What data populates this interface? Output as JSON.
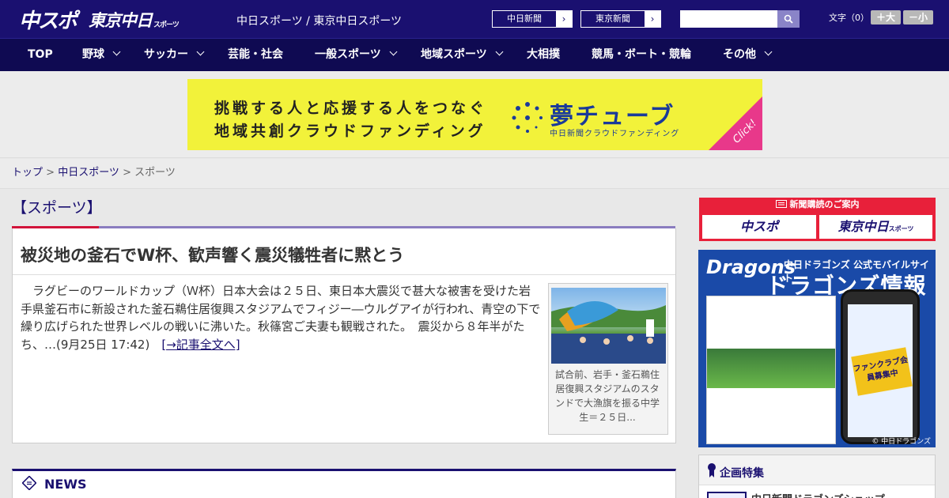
{
  "header": {
    "logo_chuspo": "中スポ",
    "logo_tokyo": "東京中日",
    "logo_tokyo_small": "スポーツ",
    "site_title": "中日スポーツ / 東京中日スポーツ",
    "btn_chunichi": "中日新聞",
    "btn_tokyo": "東京新聞",
    "arrow": "›",
    "search_placeholder": "",
    "fontsize_label": "文字（0）",
    "fs_big": "＋大",
    "fs_small": "－小"
  },
  "nav": {
    "items": [
      {
        "label": "TOP"
      },
      {
        "label": "野球"
      },
      {
        "label": "サッカー"
      },
      {
        "label": "芸能・社会"
      },
      {
        "label": "一般スポーツ"
      },
      {
        "label": "地域スポーツ"
      },
      {
        "label": "大相撲"
      },
      {
        "label": "競馬・ボート・競輪"
      },
      {
        "label": "その他"
      }
    ]
  },
  "banner": {
    "line1": "挑戦する人と応援する人をつなぐ",
    "line2": "地域共創クラウドファンディング",
    "brand": "夢チューブ",
    "brand_sub": "中日新聞クラウドファンディング",
    "click": "Click!"
  },
  "breadcrumb": {
    "home": "トップ",
    "sep": " > ",
    "level1": "中日スポーツ",
    "current": "スポーツ"
  },
  "main": {
    "section_title": "【スポーツ】",
    "article": {
      "title": "被災地の釜石でW杯、歓声響く震災犠牲者に黙とう",
      "body": "　ラグビーのワールドカップ（Ｗ杯）日本大会は２５日、東日本大震災で甚大な被害を受けた岩手県釜石市に新設された釜石鵜住居復興スタジアムでフィジー―ウルグアイが行われ、青空の下で繰り広げられた世界レベルの戦いに沸いた。秋篠宮ご夫妻も観戦された。　震災から８年半がたち、…(9月25日 17:42)　",
      "more": "[→記事全文へ]",
      "caption": "試合前、岩手・釜石鵜住居復興スタジアムのスタンドで大漁旗を振る中学生＝２５日..."
    },
    "news_title": "NEWS"
  },
  "sidebar": {
    "subscribe_header": "新聞購読のご案内",
    "sub_chuspo": "中スポ",
    "sub_tokyo": "東京中日",
    "sub_tokyo_small": "スポーツ",
    "dragons_logo": "Dragons",
    "dragons_sub": "中日ドラゴンズ 公式モバイルサイト",
    "dragons_main": "ドラゴンズ情報",
    "dragons_badge": "ファンクラブ会員募集中",
    "dragons_copy": "© 中日ドラゴンズ",
    "kikaku_title": "企画特集",
    "kikaku_item": "中日新聞ドラゴンズショップ"
  },
  "colors": {
    "header_bg": "#1a1070",
    "nav_bg": "#0f0a52",
    "accent_red": "#d2143a",
    "banner_yellow": "#f2f23a"
  }
}
